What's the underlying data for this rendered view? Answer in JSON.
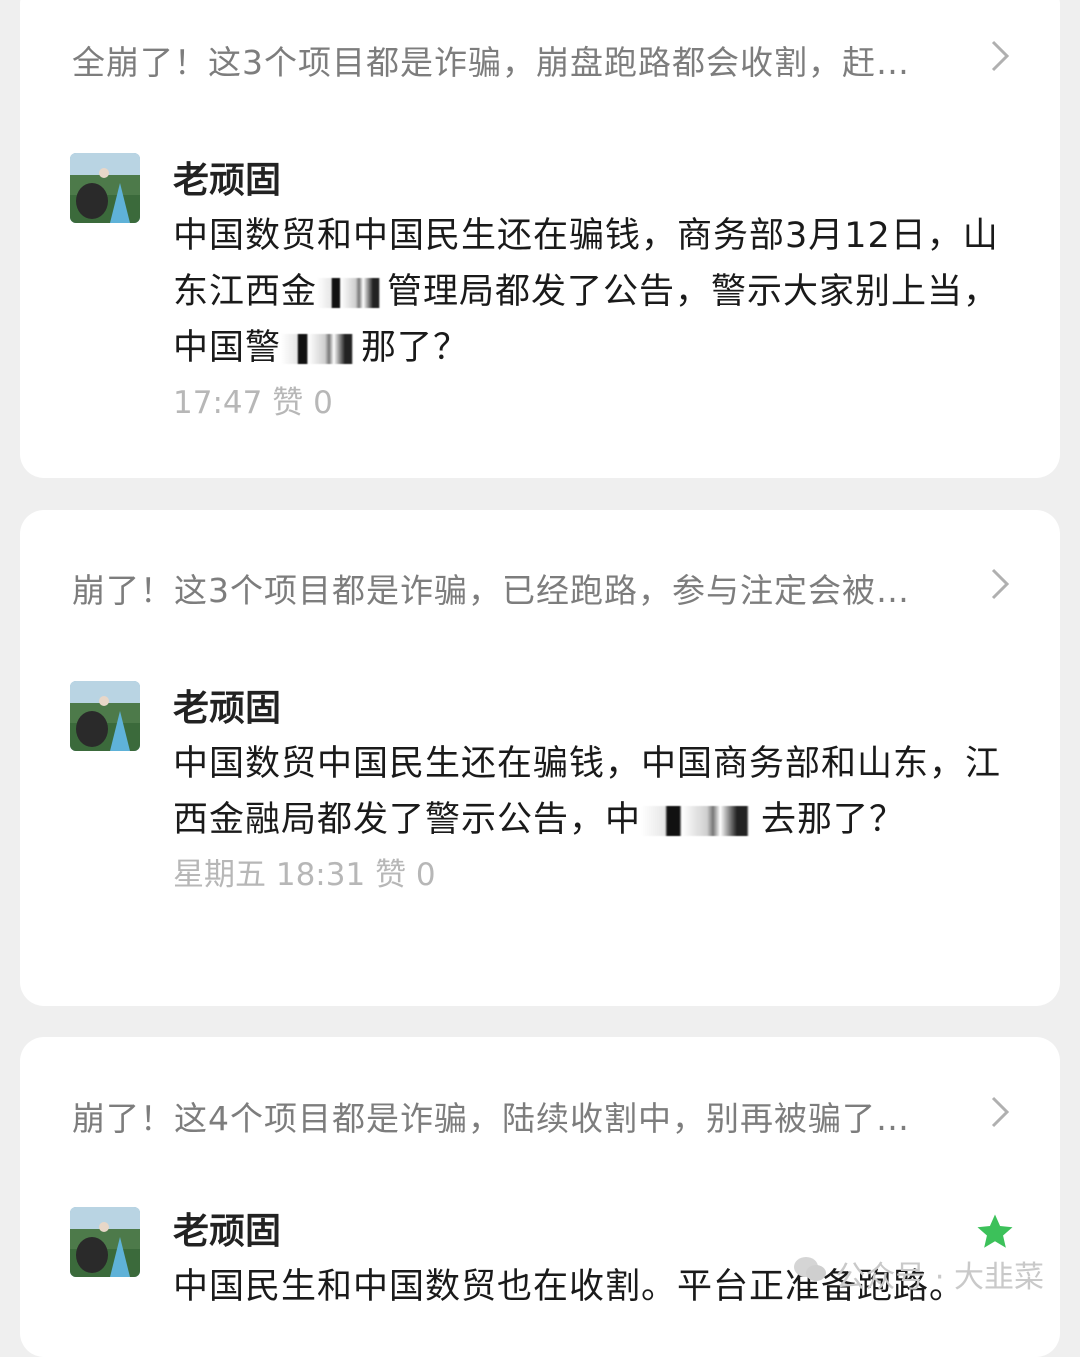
{
  "cards": [
    {
      "article_title": "全崩了！这3个项目都是诈骗，崩盘跑路都会收割，赶…",
      "user": "老顽固",
      "text_parts": [
        "中国数贸和中国民生还在骗钱，商务部3月12日，山东江西金",
        "管理局都发了公告，警示大家别上当，中国警",
        "那了？"
      ],
      "time": "17:47",
      "likes_label": "赞",
      "likes": "0"
    },
    {
      "article_title": "崩了！这3个项目都是诈骗，已经跑路，参与注定会被…",
      "user": "老顽固",
      "text_parts": [
        "中国数贸中国民生还在骗钱，中国商务部和山东，江西金融局都发了警示公告，中",
        "去那了？"
      ],
      "time": "星期五 18:31",
      "likes_label": "赞",
      "likes": "0"
    },
    {
      "article_title": "崩了！这4个项目都是诈骗，陆续收割中，别再被骗了…",
      "user": "老顽固",
      "text_parts": [
        "中国民生和中国数贸也在收割。平台正准备跑路。"
      ]
    }
  ],
  "watermark": "公众号 · 大韭菜",
  "colors": {
    "star": "#3cc15a",
    "bg": "#efefef",
    "card": "#ffffff"
  },
  "icons": {
    "chevron": "chevron-right-icon",
    "star": "star-icon",
    "watermark": "wechat-icon"
  }
}
